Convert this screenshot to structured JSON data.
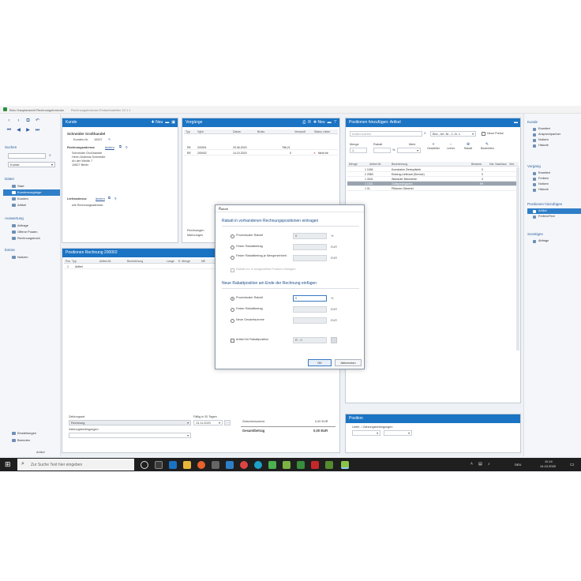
{
  "window": {
    "title": "Büro Hauptansicht Rechnungsformular",
    "subtitle": "Rechnungsformular Einfachtabellen 22.1.1"
  },
  "left_nav": {
    "search_label": "Suchen",
    "search_select": "Kunde",
    "sections": [
      {
        "label": "Daten",
        "items": [
          "Start",
          "Kundenvorgänge",
          "Kunden",
          "Artikel"
        ]
      },
      {
        "label": "Auswertung",
        "items": [
          "Abfrage",
          "Offene Posten",
          "Rechnungsbuch"
        ]
      },
      {
        "label": "Extras",
        "items": [
          "Notizen"
        ]
      }
    ],
    "bottom_items": [
      "Einstellungen",
      "Beenden"
    ],
    "status": "Artikel"
  },
  "kunde_panel": {
    "title": "Kunde",
    "new_label": "Neu",
    "company": "Schneider Großhandel",
    "customer_no_label": "Kunden-Nr.",
    "customer_no": "10007",
    "billing_label": "Rechnungsadresse",
    "billing_link": "ändern",
    "address_lines": [
      "Schneider Großhandel",
      "Herrn Andreas Schneider",
      "An der Weide 7",
      "10827 Berlin"
    ],
    "delivery_label": "Lieferadresse",
    "delivery_link": "ändern",
    "delivery_value": "wie Rechnungsadresse"
  },
  "vorgaenge_panel": {
    "title": "Vorgänge",
    "new_label": "Neu",
    "columns": [
      "Typ",
      "VgNr",
      "Datum",
      "Brutto",
      "Versandt",
      "Status Listen"
    ],
    "rows": [
      {
        "typ": "RE",
        "nr": "200001",
        "datum": "20.06.2020",
        "brutto": "786,21",
        "versandt": "",
        "status": ""
      },
      {
        "typ": "RE",
        "nr": "200002",
        "datum": "14.10.2020",
        "brutto": "0",
        "versandt": "",
        "status": "Nicht be"
      }
    ],
    "footer_1": "Rechnungen",
    "footer_2": "Mahnungen"
  },
  "positionen_panel": {
    "title": "Positionen Rechnung 200002",
    "columns": [
      "Pos",
      "Typ",
      "Artikel-Nr.",
      "Bezeichnung",
      "Lange",
      "E. Menge",
      "ME"
    ],
    "rows": [
      {
        "pos": "1",
        "typ": "Artikel"
      }
    ],
    "zahlungsart_label": "Zahlungsart",
    "zahlungsart_value": "Rechnung",
    "faellig_label": "Fällig in 30 Tagen",
    "faellig_value": "13.11.2020",
    "bedingungen_label": "Zahlungsbedingungen",
    "zwischensumme_label": "Zwischensumme",
    "zwischensumme_value": "0,00 EUR",
    "gesamt_label": "Gesamtbetrag",
    "gesamt_value": "0,00 EUR"
  },
  "artikel_panel": {
    "title": "Positionen hinzufügen: Artikel",
    "search_placeholder": "Artikel suchen",
    "filter_value": "Bez., Art.-Nr., 1.-N. 1",
    "checkbox_label": "Neue Preise",
    "menge_label": "Menge",
    "menge_value": "1",
    "rabatt_label": "Rabatt",
    "rabatt_unit": "%",
    "merk_label": "Merk",
    "tools": [
      {
        "glyph": "+",
        "label": "Gewählter"
      },
      {
        "glyph": "↓",
        "label": "Leerer"
      },
      {
        "glyph": "⊕",
        "label": "Rabatt"
      },
      {
        "glyph": "✎",
        "label": "Bearbeiten"
      }
    ],
    "columns": [
      "Menge",
      "Artikel-Nr.",
      "Bezeichnung",
      "Bestand",
      "Kat. Nachlass",
      "Verl."
    ],
    "rows": [
      {
        "nr": "1 1156",
        "bez": "Kunstrahm Zierkopfsieb",
        "bestand": "0",
        "sel": false
      },
      {
        "nr": "2 2583",
        "bez": "Eisberg-Lieferant (Service)",
        "bestand": "0",
        "sel": false
      },
      {
        "nr": "1 3041",
        "bez": "Wandzier Bäumchen",
        "bestand": "0",
        "sel": false
      },
      {
        "nr": "1 1021",
        "bez": "Golfspielergarten",
        "bestand": "99",
        "sel": true
      },
      {
        "nr": "1 01",
        "bez": "Pflanzen Sämerei",
        "bestand": "",
        "sel": false
      }
    ]
  },
  "position_panel": {
    "title": "Position",
    "field_label": "Liefer- / Zahlungsbedingungen"
  },
  "right_nav": {
    "sections": [
      {
        "label": "Kunde",
        "items": [
          "Erweitert",
          "Ansprechpartner",
          "Notizen",
          "Historie"
        ]
      },
      {
        "label": "Vorgang",
        "items": [
          "Erweitert",
          "Freitext",
          "Notizen",
          "Historie"
        ]
      },
      {
        "label": "Positionen hinzufügen",
        "items": [
          "Artikel",
          "Freitext/Text"
        ]
      },
      {
        "label": "Sonstiges",
        "items": [
          "Abfrage"
        ]
      }
    ]
  },
  "dialog": {
    "title": "Rabatt",
    "close_glyph": "×",
    "section_1": "Rabatt in vorhandenen Rechnungspositionen eintragen",
    "options_1": [
      {
        "label": "Prozentualer Rabatt",
        "value": "0",
        "unit": "%"
      },
      {
        "label": "Fester Rabattbetrag",
        "value": "",
        "unit": "EUR"
      },
      {
        "label": "Fester Rabattbetrag je Mengeneinheit",
        "value": "",
        "unit": "EUR"
      }
    ],
    "disabled_option": "Rabatt nur in ausgewählte Position eintragen",
    "section_2": "Neue Rabattposition am Ende der Rechnung einfügen",
    "options_2": [
      {
        "label": "Prozentualer Rabatt",
        "value": "0",
        "unit": "%"
      },
      {
        "label": "Fester Rabattbetrag",
        "value": "",
        "unit": "EUR"
      },
      {
        "label": "Neue Gesamtsumme",
        "value": "",
        "unit": "EUR"
      }
    ],
    "artikel_label": "Artikel für Rabattposition",
    "artikel_value": "R - 0",
    "ok_label": "OK",
    "cancel_label": "Abbrechen"
  },
  "taskbar": {
    "search_placeholder": "Zur Suche Text hier eingeben",
    "lang": "DEU",
    "time": "11:14",
    "date": "14.10.2020"
  },
  "colors": {
    "accent": "#1b73c3",
    "nav_active": "#2f7fc8",
    "taskbar": "#1f1f1f",
    "selected_row": "#9aa3ae"
  }
}
